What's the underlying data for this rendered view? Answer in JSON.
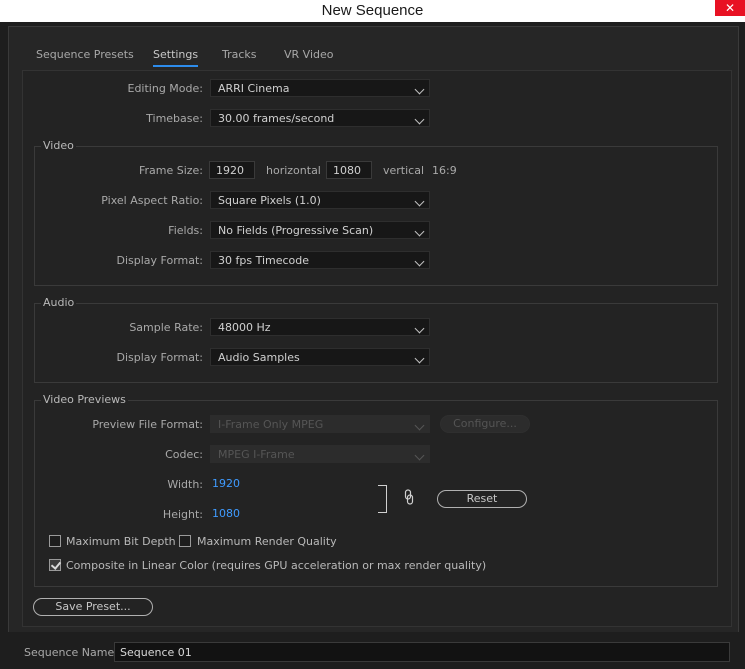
{
  "window": {
    "title": "New Sequence",
    "close_glyph": "✕"
  },
  "tabs": [
    {
      "label": "Sequence Presets",
      "active": false
    },
    {
      "label": "Settings",
      "active": true
    },
    {
      "label": "Tracks",
      "active": false
    },
    {
      "label": "VR Video",
      "active": false
    }
  ],
  "settings": {
    "editing_mode": {
      "label": "Editing Mode:",
      "value": "ARRI Cinema"
    },
    "timebase": {
      "label": "Timebase:",
      "value": "30.00  frames/second"
    }
  },
  "video": {
    "group_label": "Video",
    "frame_size": {
      "label": "Frame Size:",
      "width": "1920",
      "horizontal_label": "horizontal",
      "height": "1080",
      "vertical_label": "vertical",
      "aspect": "16:9"
    },
    "pixel_aspect_ratio": {
      "label": "Pixel Aspect Ratio:",
      "value": "Square Pixels (1.0)"
    },
    "fields": {
      "label": "Fields:",
      "value": "No Fields (Progressive Scan)"
    },
    "display_format": {
      "label": "Display Format:",
      "value": "30 fps Timecode"
    }
  },
  "audio": {
    "group_label": "Audio",
    "sample_rate": {
      "label": "Sample Rate:",
      "value": "48000 Hz"
    },
    "display_format": {
      "label": "Display Format:",
      "value": "Audio Samples"
    }
  },
  "video_previews": {
    "group_label": "Video Previews",
    "preview_file_format": {
      "label": "Preview File Format:",
      "value": "I-Frame Only MPEG",
      "disabled": true
    },
    "configure_button": "Configure...",
    "codec": {
      "label": "Codec:",
      "value": "MPEG I-Frame",
      "disabled": true
    },
    "width": {
      "label": "Width:",
      "value": "1920"
    },
    "height": {
      "label": "Height:",
      "value": "1080"
    },
    "reset_button": "Reset",
    "max_bit_depth": {
      "label": "Maximum Bit Depth",
      "checked": false
    },
    "max_render_quality": {
      "label": "Maximum Render Quality",
      "checked": false
    },
    "composite_linear": {
      "label": "Composite in Linear Color (requires GPU acceleration or max render quality)",
      "checked": true
    }
  },
  "save_preset_button": "Save Preset...",
  "sequence_name": {
    "label": "Sequence Name:",
    "value": "Sequence 01"
  },
  "colors": {
    "accent": "#2d8ceb",
    "value_blue": "#3f9bff",
    "close_red": "#e81123"
  },
  "icons": {
    "link": "link-icon",
    "chevron": "chevron-down-icon",
    "check": "check-icon",
    "close": "close-icon"
  }
}
